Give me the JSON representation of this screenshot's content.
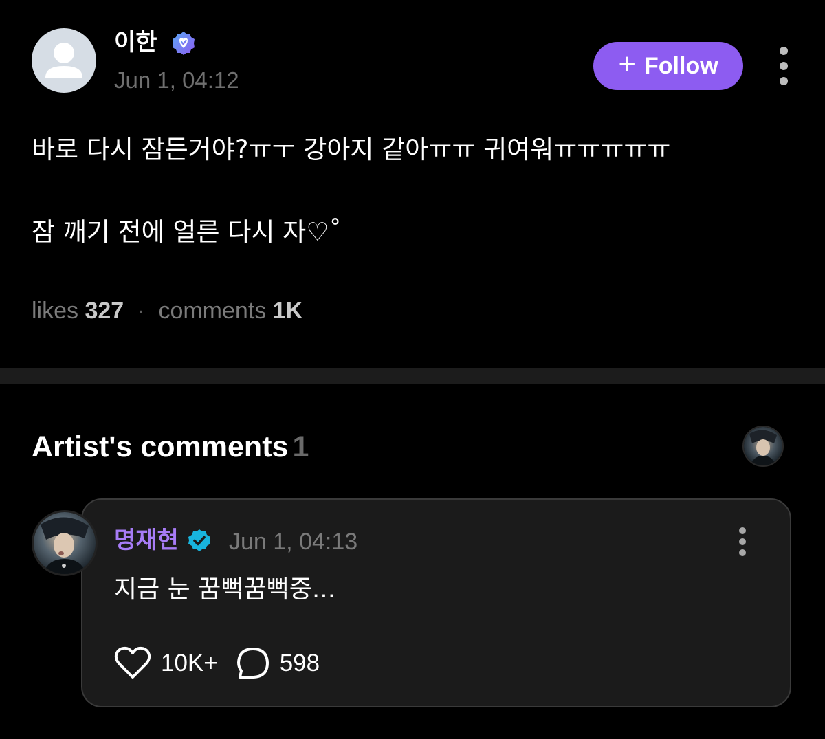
{
  "post": {
    "author_name": "이한",
    "timestamp": "Jun 1, 04:12",
    "follow_label": "Follow",
    "body_line1": "바로 다시 잠든거야?ㅠㅜ 강아지 같아ㅠㅠ 귀여워ㅠㅠㅠㅠㅠ",
    "body_line2": "잠 깨기 전에 얼른 다시 자♡˚",
    "stats": {
      "likes_label": "likes",
      "likes_count": "327",
      "separator": "·",
      "comments_label": "comments",
      "comments_count": "1K"
    }
  },
  "artist_comments": {
    "title": "Artist's comments",
    "count": "1"
  },
  "comment": {
    "author_name": "명재현",
    "timestamp": "Jun 1, 04:13",
    "text": "지금 눈 꿈뻑꿈뻑중...",
    "likes": "10K+",
    "replies": "598"
  },
  "colors": {
    "background": "#000000",
    "accent_purple": "#8d5cf1",
    "artist_name_purple": "#a77cf6",
    "verified_blue": "#18b4dd",
    "card_background": "#1b1b1b",
    "muted_text": "#7a7a7a"
  },
  "icons": {
    "author_verified": "verified-badge-purple",
    "artist_verified": "verified-badge-blue",
    "more": "vertical-dots",
    "like": "heart-outline",
    "reply": "speech-bubble-outline"
  }
}
